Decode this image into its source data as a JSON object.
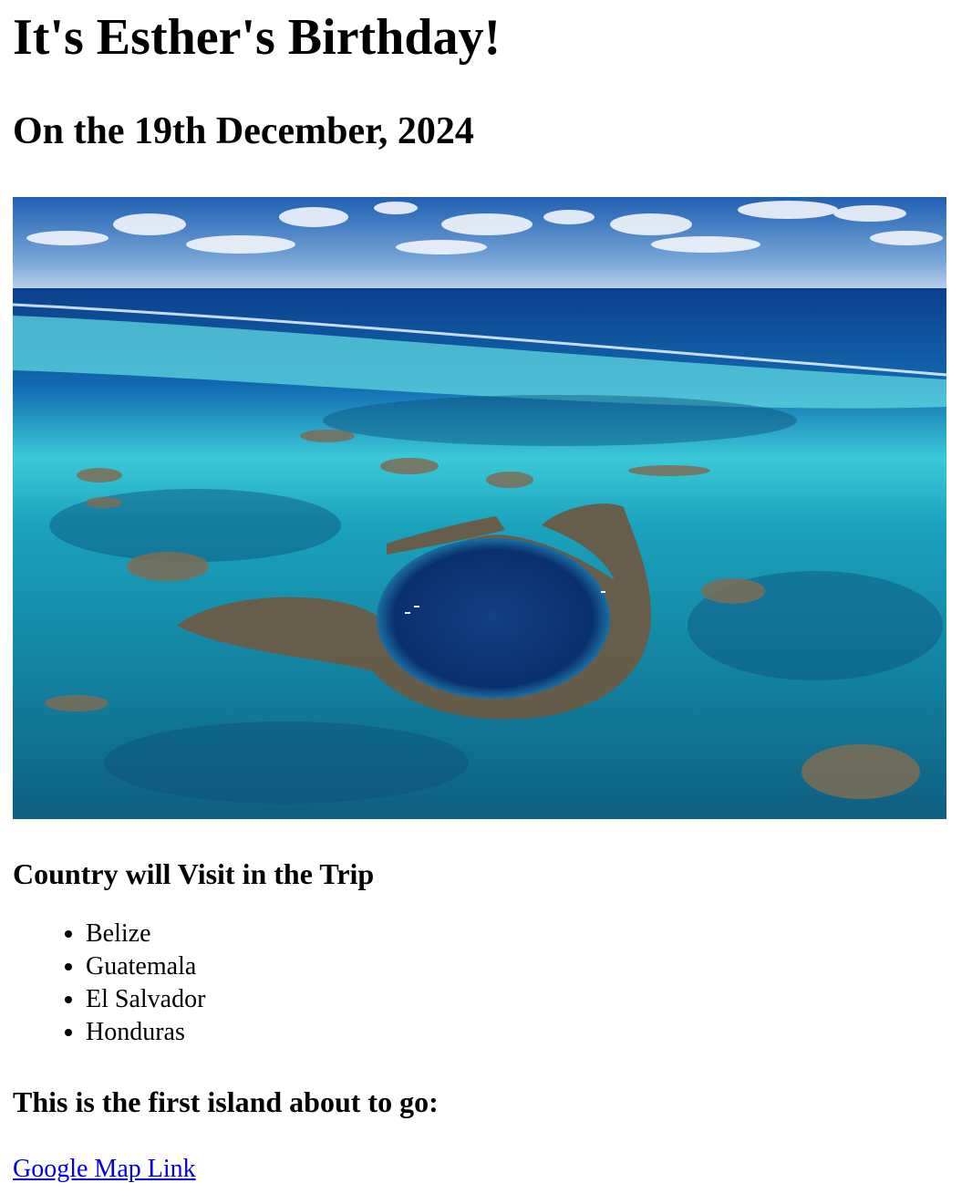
{
  "header": {
    "title": "It's Esther's Birthday!",
    "date": "On the 19th December, 2024"
  },
  "photo": {
    "subject": "aerial ocean reef with a circular blue sinkhole",
    "colors": {
      "sky_top": "#1f5fb3",
      "sky_bottom": "#bcd3ea",
      "deep_ocean": "#0b3f8c",
      "lagoon": "#26b7c9",
      "shallow": "#5fd7e0",
      "reef": "#6a5b45",
      "sinkhole": "#0a2f6e"
    }
  },
  "trip": {
    "heading": "Country will Visit in the Trip",
    "countries": [
      "Belize",
      "Guatemala",
      "El Salvador",
      "Honduras"
    ]
  },
  "island": {
    "heading": "This is the first island about to go:",
    "link_text": "Google Map Link"
  }
}
